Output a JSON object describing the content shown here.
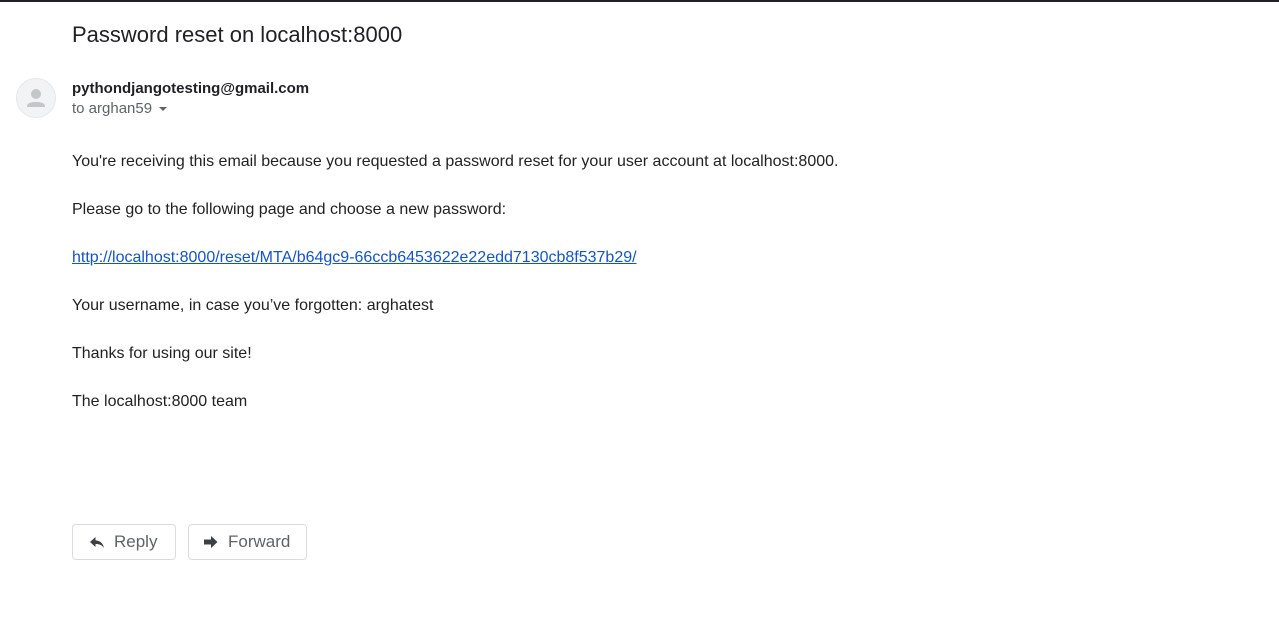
{
  "email": {
    "subject": "Password reset on localhost:8000",
    "sender": "pythondjangotesting@gmail.com",
    "recipient": "to arghan59",
    "body": {
      "line1": "You're receiving this email because you requested a password reset for your user account at localhost:8000.",
      "line2": "Please go to the following page and choose a new password:",
      "reset_link": "http://localhost:8000/reset/MTA/b64gc9-66ccb6453622e22edd7130cb8f537b29/",
      "line3": "Your username, in case you’ve forgotten: arghatest",
      "line4": "Thanks for using our site!",
      "line5": "The localhost:8000 team"
    }
  },
  "actions": {
    "reply_label": "Reply",
    "forward_label": "Forward"
  },
  "icons": {
    "avatar": "person-icon",
    "recipient_details": "chevron-down-icon",
    "reply": "reply-arrow-icon",
    "forward": "forward-arrow-icon"
  },
  "colors": {
    "link": "#1155cc",
    "text": "#222222",
    "muted": "#5f6368",
    "button_border": "#dadce0"
  }
}
